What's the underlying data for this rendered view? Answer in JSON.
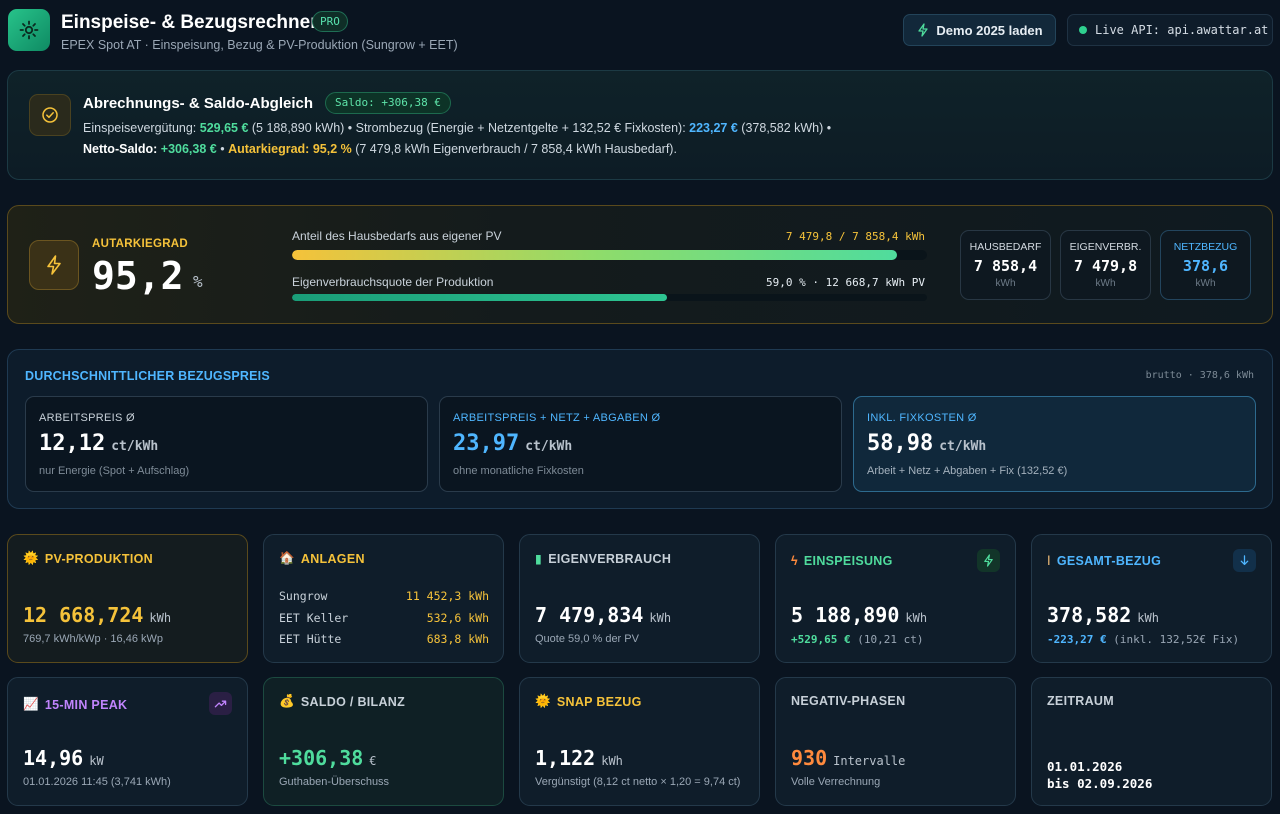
{
  "header": {
    "title": "Einspeise- & Bezugsrechner",
    "badge": "PRO",
    "subtitle": "EPEX Spot AT · Einspeisung, Bezug & PV-Produktion (Sungrow + EET)",
    "demo_button": "Demo 2025 laden",
    "api_status": "Live API: api.awattar.at"
  },
  "saldo": {
    "title": "Abrechnungs- & Saldo-Abgleich",
    "badge": "Saldo: +306,38 €",
    "line1_a": "Einspeisevergütung: ",
    "line1_b": "529,65 €",
    "line1_c": " (5 188,890 kWh) • Strombezug (Energie + Netzentgelte + 132,52 € Fixkosten): ",
    "line1_d": "223,27 €",
    "line1_e": " (378,582 kWh) •",
    "line2_a": "Netto-Saldo: ",
    "line2_b": "+306,38 €",
    "line2_c": " • ",
    "line2_d": "Autarkiegrad: 95,2 %",
    "line2_e": " (7 479,8 kWh Eigenverbrauch / 7 858,4 kWh Hausbedarf)."
  },
  "autarkie": {
    "label": "AUTARKIEGRAD",
    "value": "95,2",
    "unit": "%",
    "bar1_label": "Anteil des Hausbedarfs aus eigener PV",
    "bar1_value": "7 479,8 / 7 858,4 kWh",
    "bar1_fraction": 0.952,
    "bar2_label": "Eigenverbrauchsquote der Produktion",
    "bar2_value": "59,0 % · 12 668,7 kWh PV",
    "bar2_fraction": 0.59,
    "stats": [
      {
        "label": "HAUSBEDARF",
        "value": "7 858,4",
        "unit": "kWh",
        "color": "#d3dae1"
      },
      {
        "label": "EIGENVERBR.",
        "value": "7 479,8",
        "unit": "kWh",
        "color": "#d3dae1"
      },
      {
        "label": "NETZBEZUG",
        "value": "378,6",
        "unit": "kWh",
        "color": "#4fb6ff"
      }
    ]
  },
  "preis": {
    "title": "DURCHSCHNITTLICHER BEZUGSPREIS",
    "meta": "brutto · 378,6 kWh",
    "cards": [
      {
        "label": "ARBEITSPREIS Ø",
        "value": "12,12",
        "unit": "ct/kWh",
        "note": "nur Energie (Spot + Aufschlag)"
      },
      {
        "label": "ARBEITSPREIS + NETZ + ABGABEN Ø",
        "value": "23,97",
        "unit": "ct/kWh",
        "note": "ohne monatliche Fixkosten"
      },
      {
        "label": "INKL. FIXKOSTEN Ø",
        "value": "58,98",
        "unit": "ct/kWh",
        "note": "Arbeit + Netz + Abgaben + Fix (132,52 €)"
      }
    ]
  },
  "cards": {
    "pv": {
      "title": "PV-PRODUKTION",
      "value": "12 668,724",
      "unit": "kWh",
      "note": "769,7 kWh/kWp · 16,46 kWp"
    },
    "anlagen": {
      "title": "ANLAGEN",
      "rows": [
        {
          "name": "Sungrow",
          "value": "11 452,3 kWh"
        },
        {
          "name": "EET Keller",
          "value": "532,6 kWh"
        },
        {
          "name": "EET Hütte",
          "value": "683,8 kWh"
        }
      ]
    },
    "eigen": {
      "title": "EIGENVERBRAUCH",
      "value": "7 479,834",
      "unit": "kWh",
      "note": "Quote 59,0 % der PV"
    },
    "einspeisung": {
      "title": "EINSPEISUNG",
      "value": "5 188,890",
      "unit": "kWh",
      "note_a": "+529,65 €",
      "note_b": " (10,21 ct)"
    },
    "bezug": {
      "title": "GESAMT-BEZUG",
      "value": "378,582",
      "unit": "kWh",
      "note_a": "-223,27 €",
      "note_b": " (inkl. 132,52€ Fix)"
    },
    "peak": {
      "title": "15-MIN PEAK",
      "value": "14,96",
      "unit": "kW",
      "note": "01.01.2026 11:45 (3,741 kWh)"
    },
    "saldo": {
      "title": "SALDO / BILANZ",
      "value": "+306,38",
      "unit": "€",
      "note": "Guthaben-Überschuss"
    },
    "snap": {
      "title": "SNAP BEZUG",
      "value": "1,122",
      "unit": "kWh",
      "note": "Vergünstigt (8,12 ct netto × 1,20 = 9,74 ct)"
    },
    "negativ": {
      "title": "NEGATIV-PHASEN",
      "value": "930",
      "unit": "Intervalle",
      "note": "Volle Verrechnung"
    },
    "zeitraum": {
      "title": "ZEITRAUM",
      "from": "01.01.2026",
      "to": "bis 02.09.2026"
    }
  },
  "colors": {
    "accent_green": "#4fdc9d",
    "accent_blue": "#4fb6ff",
    "accent_yellow": "#f5c23a",
    "accent_purple": "#c084fc",
    "accent_orange": "#ff8a3d"
  }
}
